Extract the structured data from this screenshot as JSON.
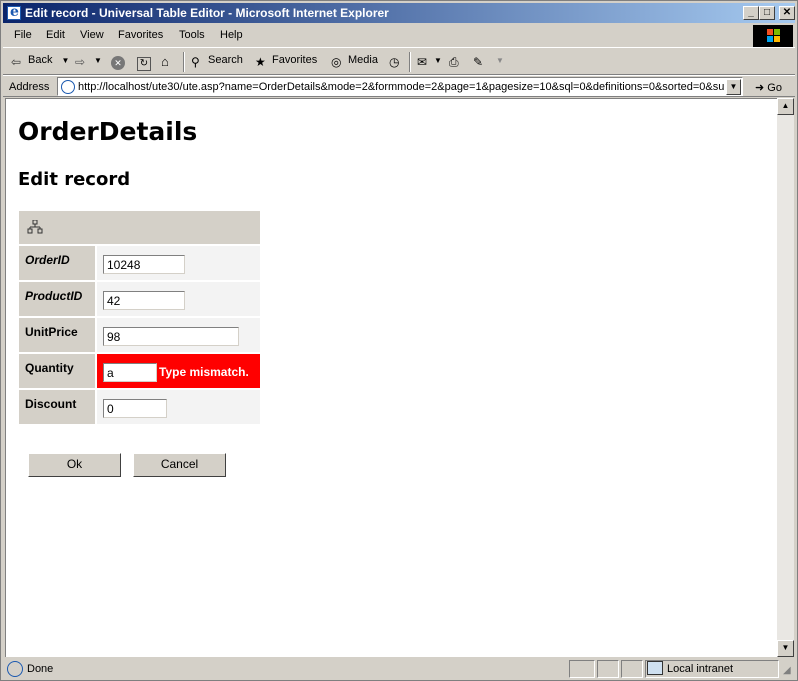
{
  "window": {
    "title": "Edit record - Universal Table Editor - Microsoft Internet Explorer",
    "min_glyph": "_",
    "max_glyph": "□",
    "close_glyph": "✕"
  },
  "menu": [
    "File",
    "Edit",
    "View",
    "Favorites",
    "Tools",
    "Help"
  ],
  "toolbar": {
    "back": "Back",
    "search": "Search",
    "favorites": "Favorites",
    "media": "Media"
  },
  "address": {
    "label": "Address",
    "url": "http://localhost/ute30/ute.asp?name=OrderDetails&mode=2&formmode=2&page=1&pagesize=10&sql=0&definitions=0&sorted=0&su",
    "go": "Go"
  },
  "page": {
    "title": "OrderDetails",
    "subtitle": "Edit record",
    "fields": [
      {
        "label": "OrderID",
        "value": "10248",
        "key": true
      },
      {
        "label": "ProductID",
        "value": "42",
        "key": true
      },
      {
        "label": "UnitPrice",
        "value": "98",
        "key": false
      },
      {
        "label": "Quantity",
        "value": "a",
        "key": false,
        "error": "Type mismatch."
      },
      {
        "label": "Discount",
        "value": "0",
        "key": false
      }
    ],
    "ok_label": "Ok",
    "cancel_label": "Cancel"
  },
  "status": {
    "text": "Done",
    "zone": "Local intranet"
  },
  "colors": {
    "error_bg": "#ff0000",
    "label_bg": "#d4d0c8",
    "cell_bg": "#f3f3f3"
  }
}
